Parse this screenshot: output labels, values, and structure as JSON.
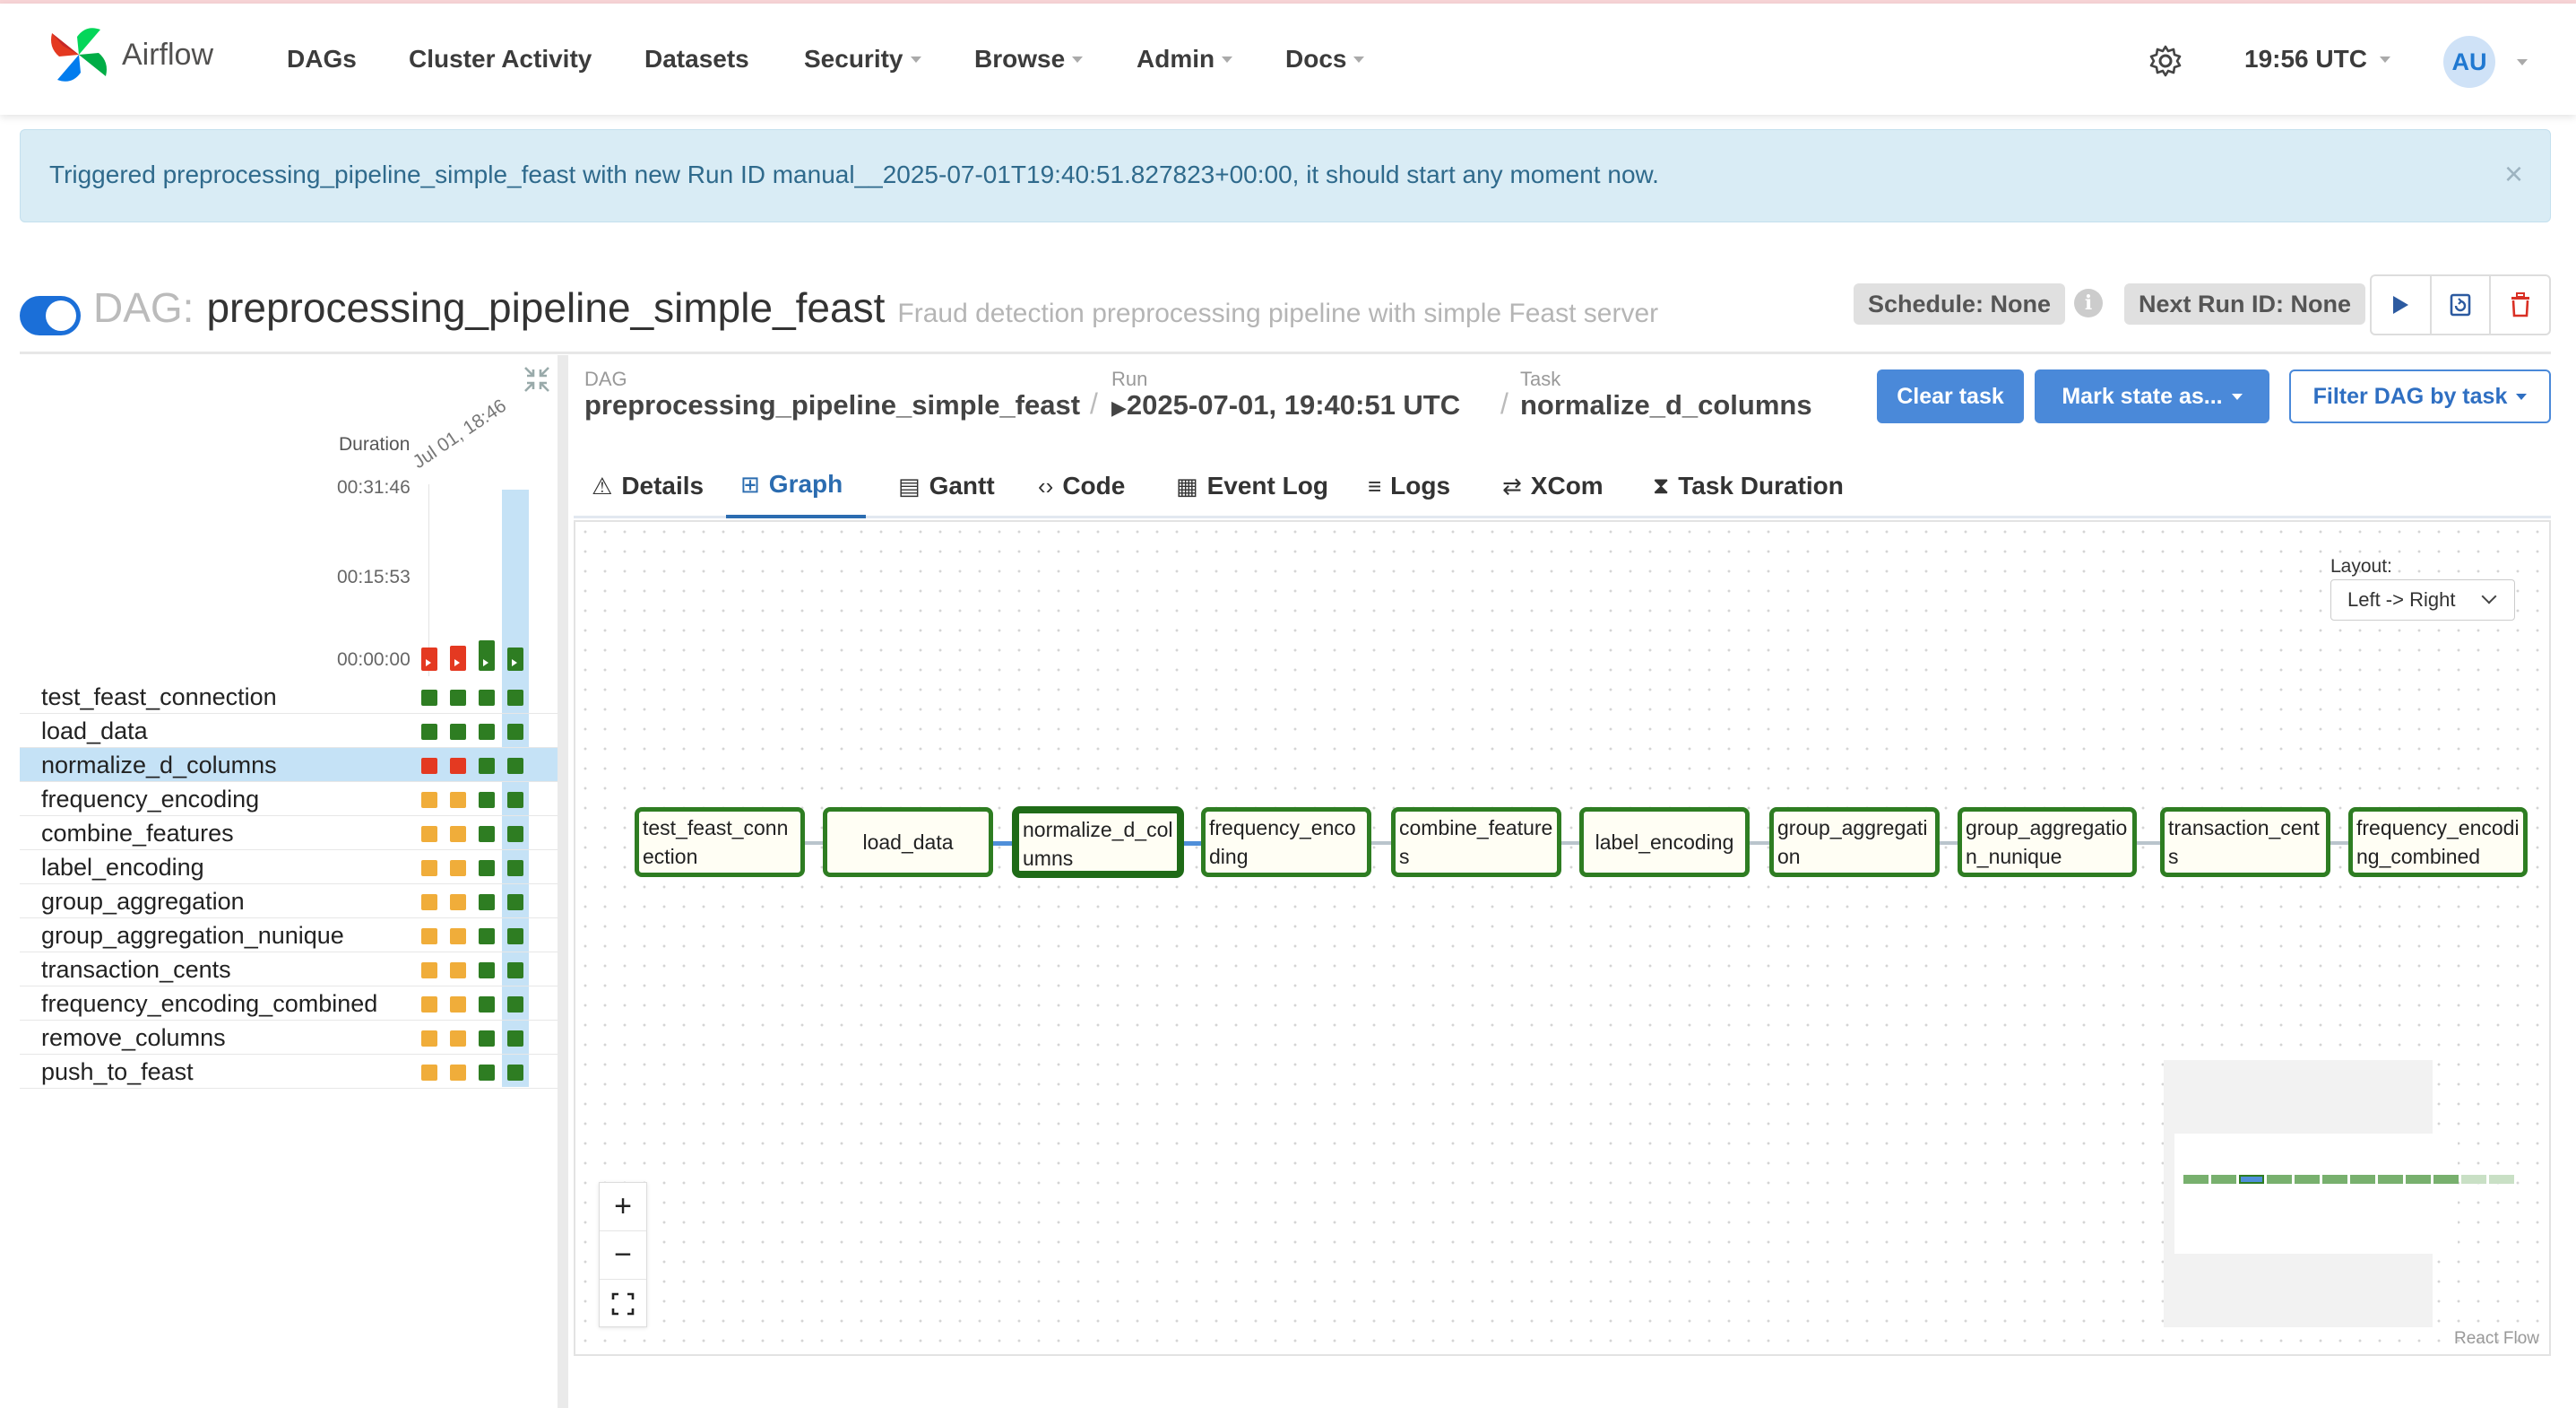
{
  "nav": {
    "brand": "Airflow",
    "items": [
      "DAGs",
      "Cluster Activity",
      "Datasets",
      "Security",
      "Browse",
      "Admin",
      "Docs"
    ],
    "time": "19:56 UTC",
    "avatar_initials": "AU"
  },
  "alert": {
    "message": "Triggered preprocessing_pipeline_simple_feast with new Run ID manual__2025-07-01T19:40:51.827823+00:00, it should start any moment now.",
    "close": "×"
  },
  "dag": {
    "label": "DAG:",
    "name": "preprocessing_pipeline_simple_feast",
    "description": "Fraud detection preprocessing pipeline with simple Feast server",
    "schedule": "Schedule: None",
    "next_run": "Next Run ID: None",
    "paused": false
  },
  "grid": {
    "duration_label": "Duration",
    "date_label": "Jul 01, 18:46",
    "ticks": [
      "00:31:46",
      "00:15:53",
      "00:00:00"
    ],
    "run_bars": [
      {
        "color": "#e43921",
        "height_ratio": 0.12
      },
      {
        "color": "#e43921",
        "height_ratio": 0.13
      },
      {
        "color": "#2e7d22",
        "height_ratio": 0.16
      },
      {
        "color": "#2e7d22",
        "height_ratio": 0.12
      }
    ],
    "tasks": [
      {
        "name": "test_feast_connection",
        "states": [
          "#2e7d22",
          "#2e7d22",
          "#2e7d22",
          "#2e7d22"
        ]
      },
      {
        "name": "load_data",
        "states": [
          "#2e7d22",
          "#2e7d22",
          "#2e7d22",
          "#2e7d22"
        ]
      },
      {
        "name": "normalize_d_columns",
        "states": [
          "#e43921",
          "#e43921",
          "#2e7d22",
          "#2e7d22"
        ],
        "selected": true
      },
      {
        "name": "frequency_encoding",
        "states": [
          "#f0ad3a",
          "#f0ad3a",
          "#2e7d22",
          "#2e7d22"
        ]
      },
      {
        "name": "combine_features",
        "states": [
          "#f0ad3a",
          "#f0ad3a",
          "#2e7d22",
          "#2e7d22"
        ]
      },
      {
        "name": "label_encoding",
        "states": [
          "#f0ad3a",
          "#f0ad3a",
          "#2e7d22",
          "#2e7d22"
        ]
      },
      {
        "name": "group_aggregation",
        "states": [
          "#f0ad3a",
          "#f0ad3a",
          "#2e7d22",
          "#2e7d22"
        ]
      },
      {
        "name": "group_aggregation_nunique",
        "states": [
          "#f0ad3a",
          "#f0ad3a",
          "#2e7d22",
          "#2e7d22"
        ]
      },
      {
        "name": "transaction_cents",
        "states": [
          "#f0ad3a",
          "#f0ad3a",
          "#2e7d22",
          "#2e7d22"
        ]
      },
      {
        "name": "frequency_encoding_combined",
        "states": [
          "#f0ad3a",
          "#f0ad3a",
          "#2e7d22",
          "#2e7d22"
        ]
      },
      {
        "name": "remove_columns",
        "states": [
          "#f0ad3a",
          "#f0ad3a",
          "#2e7d22",
          "#2e7d22"
        ]
      },
      {
        "name": "push_to_feast",
        "states": [
          "#f0ad3a",
          "#f0ad3a",
          "#2e7d22",
          "#2e7d22"
        ]
      }
    ]
  },
  "breadcrumb": {
    "dag_label": "DAG",
    "dag_value": "preprocessing_pipeline_simple_feast",
    "run_label": "Run",
    "run_value": "2025-07-01, 19:40:51 UTC",
    "task_label": "Task",
    "task_value": "normalize_d_columns",
    "separator": "/"
  },
  "actions": {
    "clear": "Clear task",
    "mark": "Mark state as...",
    "filter": "Filter DAG by task"
  },
  "tabs": [
    {
      "label": "Details",
      "icon": "⚠"
    },
    {
      "label": "Graph",
      "icon": "⊞",
      "active": true
    },
    {
      "label": "Gantt",
      "icon": "▤"
    },
    {
      "label": "Code",
      "icon": "‹›"
    },
    {
      "label": "Event Log",
      "icon": "▦"
    },
    {
      "label": "Logs",
      "icon": "≡"
    },
    {
      "label": "XCom",
      "icon": "⇄"
    },
    {
      "label": "Task Duration",
      "icon": "⧗"
    }
  ],
  "graph": {
    "layout_label": "Layout:",
    "layout_value": "Left -> Right",
    "nodes": [
      {
        "label": "test_feast_connection"
      },
      {
        "label": "load_data",
        "centered": true
      },
      {
        "label": "normalize_d_columns",
        "selected": true
      },
      {
        "label": "frequency_encoding"
      },
      {
        "label": "combine_features"
      },
      {
        "label": "label_encoding",
        "centered": true
      },
      {
        "label": "group_aggregation"
      },
      {
        "label": "group_aggregation_nunique"
      },
      {
        "label": "transaction_cents"
      },
      {
        "label": "frequency_encoding_combined"
      }
    ],
    "zoom_in": "+",
    "zoom_out": "−",
    "fit": "⛶",
    "attribution": "React Flow"
  },
  "colors": {
    "success": "#2e7d22",
    "failed": "#e43921",
    "upstream_failed": "#f0ad3a",
    "accent": "#4a89d9"
  }
}
